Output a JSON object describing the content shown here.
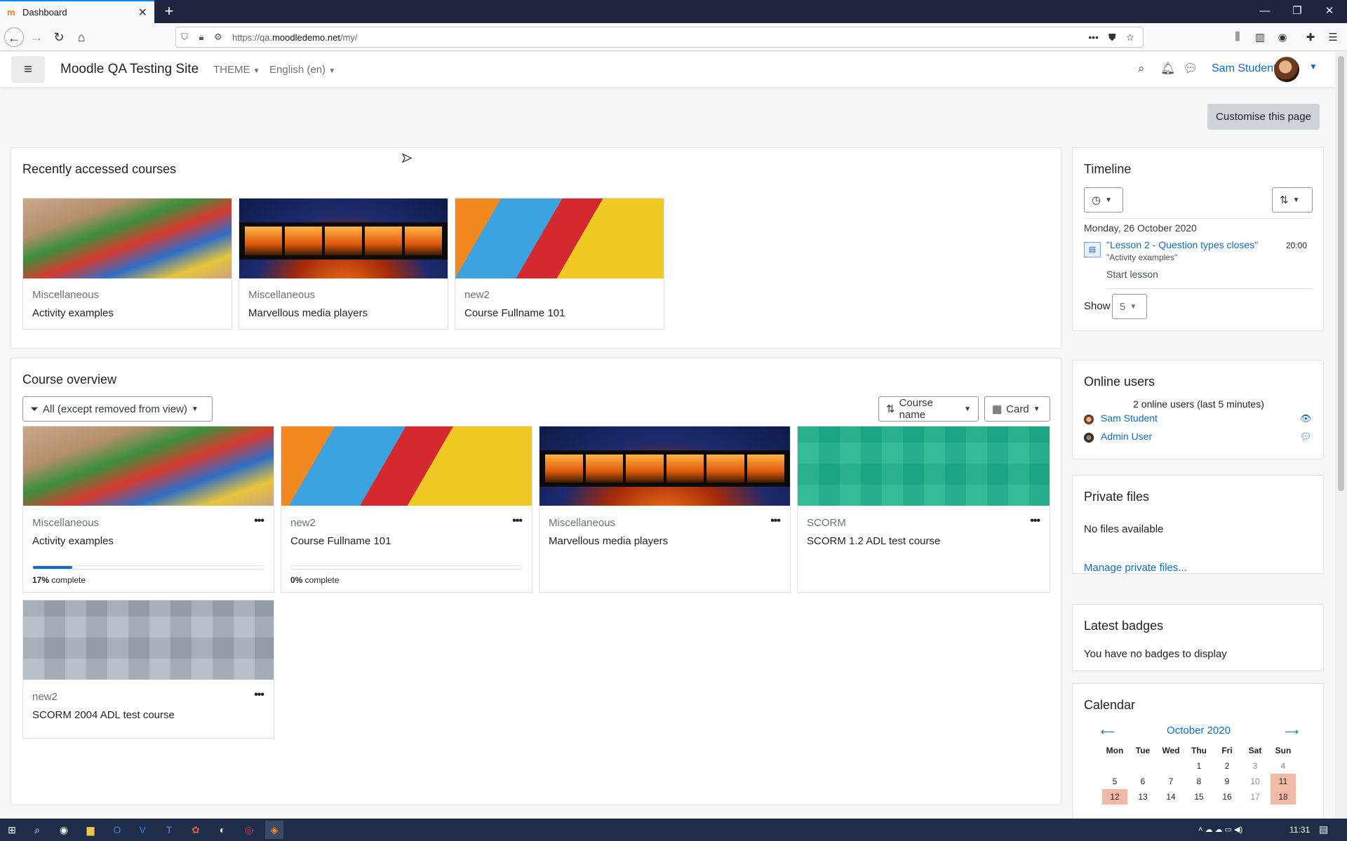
{
  "browser": {
    "tab_title": "Dashboard",
    "url_prefix": "https://qa.",
    "url_host": "moodledemo.net",
    "url_path": "/my/"
  },
  "header": {
    "site_name": "Moodle QA Testing Site",
    "theme_menu": "THEME",
    "language_menu": "English (en)",
    "user_name": "Sam Student"
  },
  "main": {
    "customise_button": "Customise this page",
    "recent": {
      "title": "Recently accessed courses",
      "courses": [
        {
          "category": "Miscellaneous",
          "name": "Activity examples",
          "image": "blocks"
        },
        {
          "category": "Miscellaneous",
          "name": "Marvellous media players",
          "image": "film"
        },
        {
          "category": "new2",
          "name": "Course Fullname 101",
          "image": "paper"
        }
      ]
    },
    "overview": {
      "title": "Course overview",
      "filter_label": "All (except removed from view)",
      "sort_label": "Course name",
      "view_label": "Card",
      "courses": [
        {
          "category": "Miscellaneous",
          "name": "Activity examples",
          "progress": 17,
          "progress_pct": "17%",
          "progress_suffix": " complete"
        },
        {
          "category": "new2",
          "name": "Course Fullname 101",
          "progress": 0,
          "progress_pct": "0%",
          "progress_suffix": " complete"
        },
        {
          "category": "Miscellaneous",
          "name": "Marvellous media players"
        },
        {
          "category": "SCORM",
          "name": "SCORM 1.2 ADL test course"
        },
        {
          "category": "new2",
          "name": "SCORM 2004 ADL test course"
        }
      ]
    }
  },
  "sidebar": {
    "timeline": {
      "title": "Timeline",
      "date": "Monday, 26 October 2020",
      "event_name": "\"Lesson 2 - Question types closes\"",
      "event_course": "\"Activity examples\"",
      "event_time": "20:00",
      "event_action": "Start lesson",
      "show_label": "Show",
      "show_value": "5"
    },
    "online_users": {
      "title": "Online users",
      "summary": "2 online users (last 5 minutes)",
      "users": [
        "Sam Student",
        "Admin User"
      ]
    },
    "private_files": {
      "title": "Private files",
      "empty": "No files available",
      "manage_link": "Manage private files..."
    },
    "badges": {
      "title": "Latest badges",
      "empty": "You have no badges to display"
    },
    "calendar": {
      "title": "Calendar",
      "month": "October 2020",
      "weekdays": [
        "Mon",
        "Tue",
        "Wed",
        "Thu",
        "Fri",
        "Sat",
        "Sun"
      ],
      "weeks": [
        [
          "",
          "",
          "",
          "1",
          "2",
          "3",
          "4"
        ],
        [
          "5",
          "6",
          "7",
          "8",
          "9",
          "10",
          "11"
        ],
        [
          "12",
          "13",
          "14",
          "15",
          "16",
          "17",
          "18"
        ]
      ],
      "highlighted": [
        "11",
        "12",
        "18"
      ]
    }
  },
  "taskbar": {
    "time": "11:31"
  }
}
